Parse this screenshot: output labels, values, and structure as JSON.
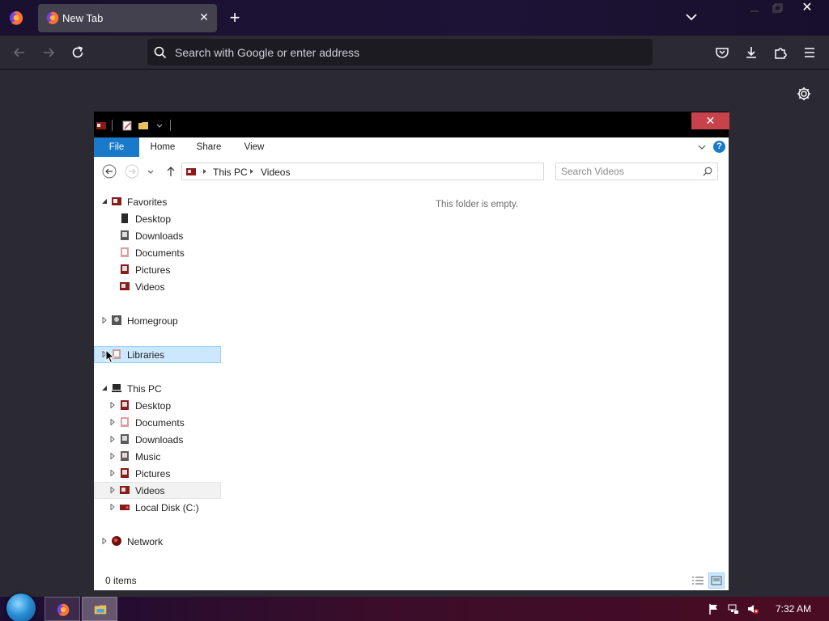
{
  "browser": {
    "tab": {
      "title": "New Tab"
    },
    "urlbar": {
      "placeholder": "Search with Google or enter address"
    }
  },
  "explorer": {
    "ribbon": {
      "tabs": [
        {
          "label": "File"
        },
        {
          "label": "Home"
        },
        {
          "label": "Share"
        },
        {
          "label": "View"
        }
      ],
      "help_label": "?"
    },
    "address": {
      "crumbs": [
        "This PC",
        "Videos"
      ]
    },
    "search": {
      "placeholder": "Search Videos"
    },
    "tree": {
      "favorites": {
        "label": "Favorites",
        "items": [
          "Desktop",
          "Downloads",
          "Documents",
          "Pictures",
          "Videos"
        ]
      },
      "homegroup": {
        "label": "Homegroup"
      },
      "libraries": {
        "label": "Libraries"
      },
      "this_pc": {
        "label": "This PC",
        "items": [
          "Desktop",
          "Documents",
          "Downloads",
          "Music",
          "Pictures",
          "Videos",
          "Local Disk (C:)"
        ]
      },
      "network": {
        "label": "Network"
      }
    },
    "empty_message": "This folder is empty.",
    "status": {
      "item_count": "0 items"
    }
  },
  "taskbar": {
    "clock": "7:32 AM"
  },
  "colors": {
    "accent": "#1979ca",
    "selection": "#cce8ff",
    "close_red": "#c7434c"
  }
}
